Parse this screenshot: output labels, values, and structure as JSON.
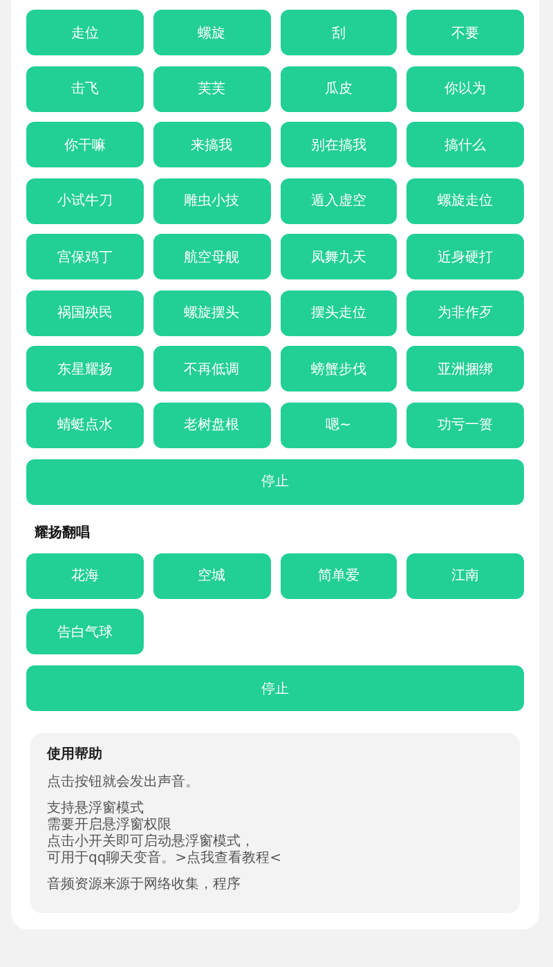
{
  "sections": [
    {
      "buttons": [
        "走位",
        "螺旋",
        "刮",
        "不要",
        "击飞",
        "芙芙",
        "瓜皮",
        "你以为",
        "你干嘛",
        "来搞我",
        "别在搞我",
        "搞什么",
        "小试牛刀",
        "雕虫小技",
        "遁入虚空",
        "螺旋走位",
        "宫保鸡丁",
        "航空母舰",
        "凤舞九天",
        "近身硬打",
        "祸国殃民",
        "螺旋摆头",
        "摆头走位",
        "为非作歹",
        "东星耀扬",
        "不再低调",
        "螃蟹步伐",
        "亚洲捆绑",
        "蜻蜓点水",
        "老树盘根",
        "嗯~",
        "功亏一篑"
      ],
      "stop": "停止"
    },
    {
      "title": "耀扬翻唱",
      "buttons": [
        "花海",
        "空城",
        "简单爱",
        "江南",
        "告白气球"
      ],
      "stop": "停止"
    }
  ],
  "help": {
    "title": "使用帮助",
    "paragraphs": [
      [
        "点击按钮就会发出声音。"
      ],
      [
        "支持悬浮窗模式",
        "需要开启悬浮窗权限",
        "点击小开关即可启动悬浮窗模式，",
        "可用于qq聊天变音。>点我查看教程<"
      ],
      [
        "音频资源来源于网络收集，程序"
      ]
    ]
  }
}
